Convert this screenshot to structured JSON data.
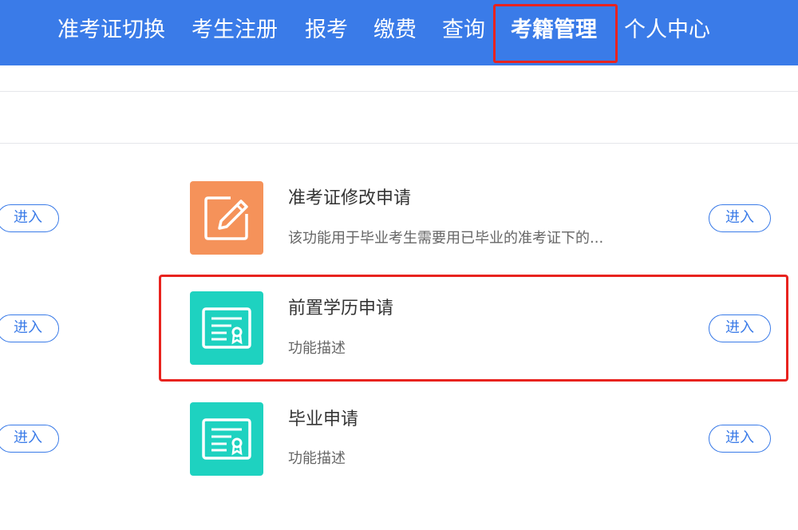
{
  "nav": {
    "items": [
      {
        "label": "准考证切换"
      },
      {
        "label": "考生注册"
      },
      {
        "label": "报考"
      },
      {
        "label": "缴费"
      },
      {
        "label": "查询"
      },
      {
        "label": "考籍管理",
        "active": true
      },
      {
        "label": "个人中心"
      }
    ]
  },
  "rows": [
    {
      "left_button": "进入",
      "icon": "pencil-edit-icon",
      "title": "准考证修改申请",
      "description": "该功能用于毕业考生需要用已毕业的准考证下的...",
      "right_button": "进入"
    },
    {
      "left_button": "进入",
      "icon": "certificate-icon",
      "title": "前置学历申请",
      "description": "功能描述",
      "right_button": "进入"
    },
    {
      "left_button": "进入",
      "icon": "certificate-icon",
      "title": "毕业申请",
      "description": "功能描述",
      "right_button": "进入"
    }
  ],
  "colors": {
    "nav_bg": "#3a7be8",
    "highlight": "#e8231f",
    "icon_orange": "#f5925a",
    "icon_teal": "#1ed2c0",
    "button_blue": "#3a7be8"
  }
}
